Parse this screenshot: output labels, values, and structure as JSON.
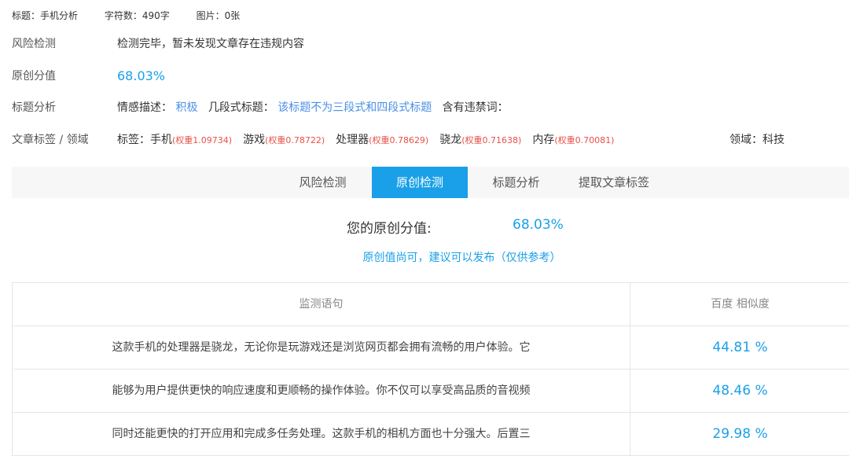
{
  "meta": {
    "title": "标题：手机分析",
    "chars": "字符数：490字",
    "images": "图片：0张"
  },
  "risk": {
    "label": "风险检测",
    "value": "检测完毕，暂未发现文章存在违规内容"
  },
  "original": {
    "label": "原创分值",
    "value": "68.03%"
  },
  "title_analysis": {
    "label": "标题分析",
    "sentiment_label": "情感描述：",
    "sentiment_value": "积极",
    "segments_label": "几段式标题：",
    "segments_value": "该标题不为三段式和四段式标题",
    "banned_label": "含有违禁词："
  },
  "tags": {
    "label": "文章标签 / 领域",
    "prefix": "标签：",
    "items": [
      {
        "name": "手机",
        "weight": "(权重1.09734)"
      },
      {
        "name": "游戏",
        "weight": "(权重0.78722)"
      },
      {
        "name": "处理器",
        "weight": "(权重0.78629)"
      },
      {
        "name": "骁龙",
        "weight": "(权重0.71638)"
      },
      {
        "name": "内存",
        "weight": "(权重0.70081)"
      }
    ],
    "domain": "领域：科技"
  },
  "tabs": [
    {
      "label": "风险检测",
      "active": false
    },
    {
      "label": "原创检测",
      "active": true
    },
    {
      "label": "标题分析",
      "active": false
    },
    {
      "label": "提取文章标签",
      "active": false
    }
  ],
  "score": {
    "label": "您的原创分值:",
    "value": "68.03%",
    "advice": "原创值尚可，建议可以发布（仅供参考）"
  },
  "table": {
    "headers": [
      "监测语句",
      "百度 相似度"
    ],
    "rows": [
      {
        "text": "这款手机的处理器是骁龙，无论你是玩游戏还是浏览网页都会拥有流畅的用户体验。它",
        "similarity": "44.81 %"
      },
      {
        "text": "能够为用户提供更快的响应速度和更顺畅的操作体验。你不仅可以享受高品质的音视频",
        "similarity": "48.46 %"
      },
      {
        "text": "同时还能更快的打开应用和完成多任务处理。这款手机的相机方面也十分强大。后置三",
        "similarity": "29.98 %"
      }
    ]
  },
  "colors": {
    "accent": "#1aa0e8",
    "link": "#4a8fe7",
    "weight": "#e8504a"
  }
}
